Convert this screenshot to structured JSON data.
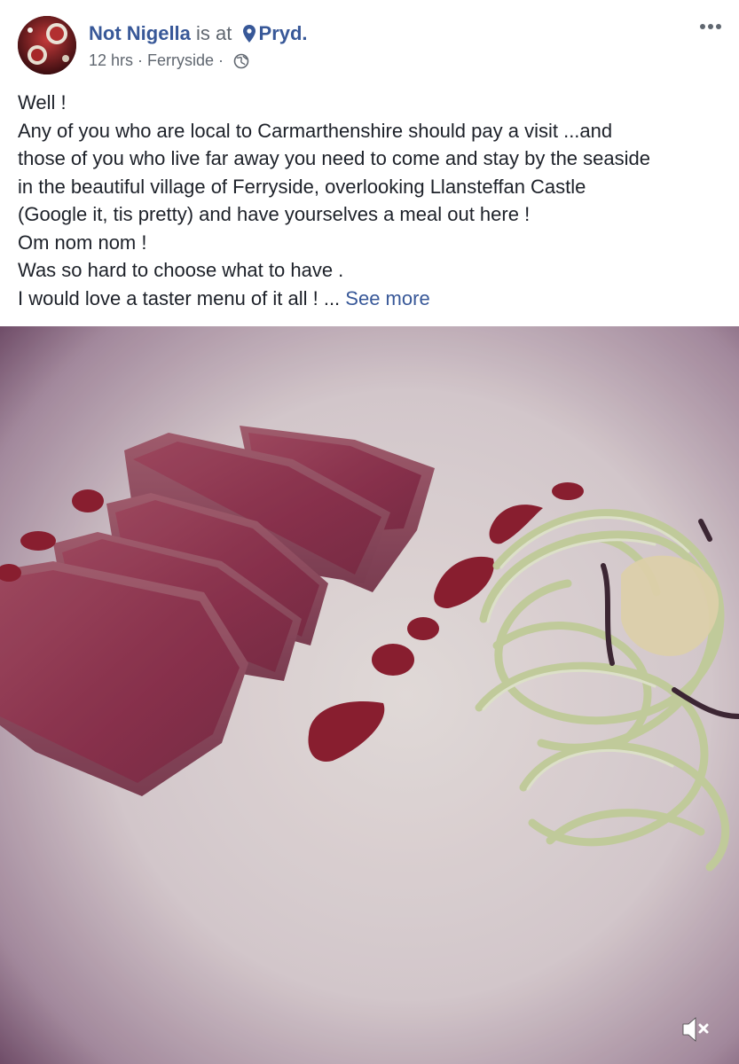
{
  "post": {
    "author": "Not Nigella",
    "verb": "is at",
    "place": "Pryd.",
    "time": "12 hrs",
    "location": "Ferryside",
    "privacy_icon": "globe-icon",
    "more_icon": "more-options-icon",
    "text_lines": [
      "Well !",
      "Any of you who are local to Carmarthenshire should pay a visit ...and",
      "those of you who live far away you need to come and stay by the seaside",
      "in the beautiful village of Ferryside, overlooking Llansteffan Castle",
      "(Google it, tis pretty) and have yourselves a meal out here !",
      "Om nom nom !",
      "Was so hard to choose what to have .",
      "I would love a taster menu of it all ! ..."
    ],
    "see_more": "See more"
  },
  "media": {
    "type": "video",
    "mute_icon": "muted-speaker-icon"
  },
  "colors": {
    "link": "#385898",
    "secondary_text": "#606770",
    "body_text": "#1d2129"
  }
}
